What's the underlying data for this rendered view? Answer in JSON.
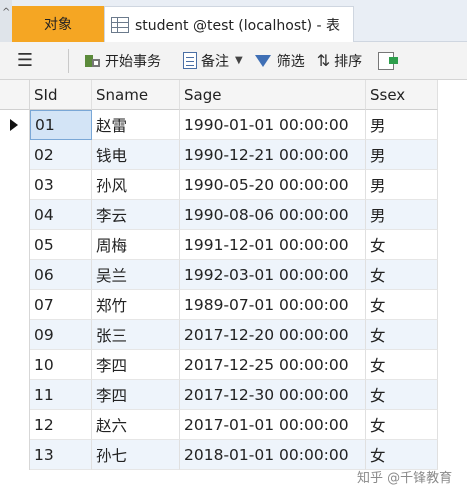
{
  "tabs": {
    "objects_label": "对象",
    "table_tab_label": "student @test (localhost) - 表"
  },
  "toolbar": {
    "menu_icon": "hamburger-icon",
    "begin_transaction_label": "开始事务",
    "memo_label": "备注",
    "filter_label": "筛选",
    "sort_label": "排序"
  },
  "grid": {
    "columns": [
      "SId",
      "Sname",
      "Sage",
      "Ssex"
    ],
    "rows": [
      [
        "01",
        "赵雷",
        "1990-01-01 00:00:00",
        "男"
      ],
      [
        "02",
        "钱电",
        "1990-12-21 00:00:00",
        "男"
      ],
      [
        "03",
        "孙风",
        "1990-05-20 00:00:00",
        "男"
      ],
      [
        "04",
        "李云",
        "1990-08-06 00:00:00",
        "男"
      ],
      [
        "05",
        "周梅",
        "1991-12-01 00:00:00",
        "女"
      ],
      [
        "06",
        "吴兰",
        "1992-03-01 00:00:00",
        "女"
      ],
      [
        "07",
        "郑竹",
        "1989-07-01 00:00:00",
        "女"
      ],
      [
        "09",
        "张三",
        "2017-12-20 00:00:00",
        "女"
      ],
      [
        "10",
        "李四",
        "2017-12-25 00:00:00",
        "女"
      ],
      [
        "11",
        "李四",
        "2017-12-30 00:00:00",
        "女"
      ],
      [
        "12",
        "赵六",
        "2017-01-01 00:00:00",
        "女"
      ],
      [
        "13",
        "孙七",
        "2018-01-01 00:00:00",
        "女"
      ]
    ],
    "selected_row_index": 0
  },
  "watermark": "知乎 @千锋教育",
  "colors": {
    "objects_tab": "#f5a623",
    "alt_row": "#eef4fb",
    "selected_cell": "#d3e4f6"
  }
}
